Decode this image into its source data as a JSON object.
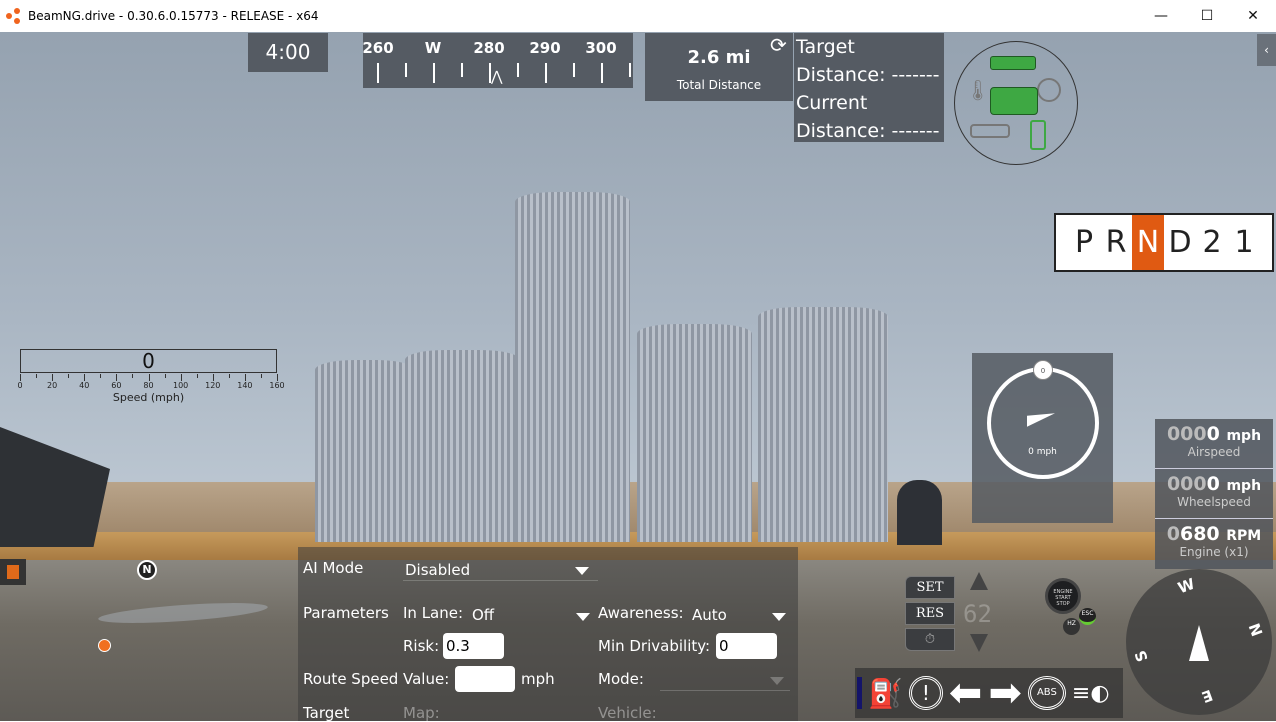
{
  "window": {
    "title": "BeamNG.drive - 0.30.6.0.15773 - RELEASE - x64",
    "minimize": "—",
    "maximize": "☐",
    "close": "✕"
  },
  "hud": {
    "timer": "4:00",
    "heading_strip": {
      "labels": [
        "260",
        "W",
        "280",
        "290",
        "300"
      ],
      "pointer": "⋀"
    },
    "total_distance": {
      "value": "2.6 mi",
      "label": "Total Distance"
    },
    "target_distance": {
      "refresh_icon": "refresh-icon",
      "line1": "Target",
      "line2": "Distance: -------",
      "line3": "Current",
      "line4": "Distance: -------"
    },
    "engine_status_icons": [
      "cylinder-head-icon",
      "coolant-temp-icon",
      "turbo-icon",
      "engine-icon",
      "oil-icon",
      "piston-icon"
    ],
    "engine_status_color": "#3ea843",
    "gearbox": {
      "gears": [
        "P",
        "R",
        "N",
        "D",
        "2",
        "1"
      ],
      "selected": "N",
      "accent": "#e05a12"
    },
    "speed_bar": {
      "value": "0",
      "ticks": [
        "0",
        "20",
        "40",
        "60",
        "80",
        "100",
        "120",
        "140",
        "160"
      ],
      "title": "Speed (mph)"
    },
    "speedometer": {
      "top_label": "0",
      "speed": "0 mph"
    },
    "readouts": [
      {
        "dim": "000",
        "value": "0",
        "unit": "mph",
        "label": "Airspeed"
      },
      {
        "dim": "000",
        "value": "0",
        "unit": "mph",
        "label": "Wheelspeed"
      },
      {
        "dim": "0",
        "value": "680",
        "unit": "RPM",
        "label": "Engine (x1)"
      }
    ],
    "minimap": {
      "north": "N"
    },
    "cruise": {
      "set": "SET",
      "res": "RES",
      "speed": "62"
    },
    "engine_button": {
      "line1": "ENGINE",
      "line2": "START",
      "line3": "STOP",
      "esc": "ESC",
      "hz": "HZ"
    },
    "compass": {
      "w": "W",
      "n": "N",
      "s": "S",
      "e": "E"
    },
    "lights": [
      "fuel-icon",
      "warning-icon",
      "left-signal-icon",
      "right-signal-icon",
      "abs-icon",
      "headlight-icon"
    ]
  },
  "ai_panel": {
    "ai_mode_label": "AI Mode",
    "ai_mode_value": "Disabled",
    "parameters_label": "Parameters",
    "in_lane_label": "In Lane:",
    "in_lane_value": "Off",
    "awareness_label": "Awareness:",
    "awareness_value": "Auto",
    "risk_label": "Risk:",
    "risk_value": "0.3",
    "min_drivability_label": "Min Drivability:",
    "min_drivability_value": "0",
    "route_speed_label": "Route Speed",
    "value_label": "Value:",
    "route_speed_value": "",
    "unit": "mph",
    "mode_label": "Mode:",
    "target_label": "Target",
    "map_label": "Map:",
    "vehicle_label": "Vehicle:"
  }
}
